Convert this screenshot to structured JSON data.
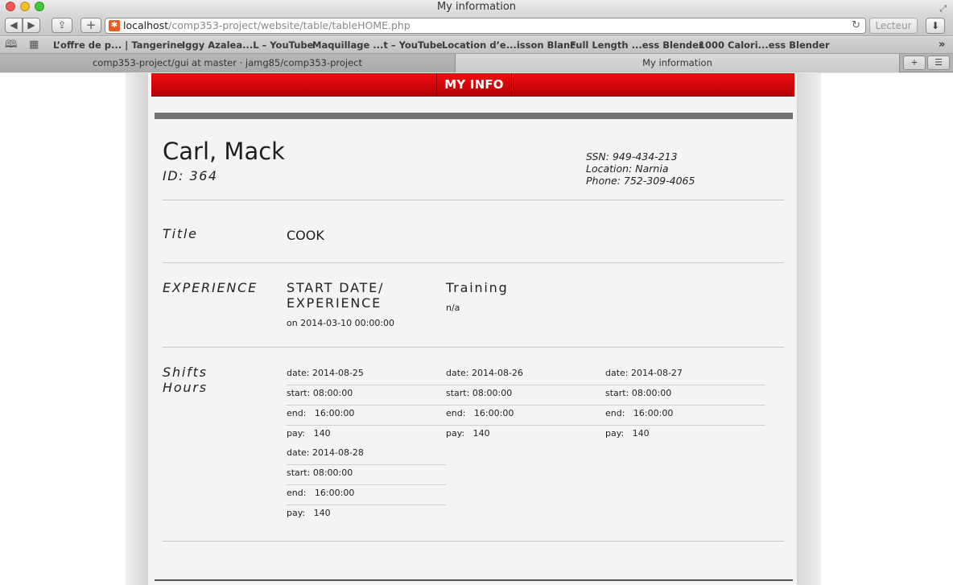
{
  "window": {
    "title": "My information"
  },
  "toolbar": {
    "back": "◀",
    "forward": "▶",
    "share": "⇪",
    "new_tab": "+",
    "url_host": "localhost",
    "url_path": "/comp353-project/website/table/tableHOME.php",
    "reader": "Lecteur",
    "reload": "↻",
    "download": "⬇"
  },
  "bookmarks": {
    "items": [
      "L’offre de p... | Tangerine",
      "Iggy Azalea...L – YouTube",
      "Maquillage ...t – YouTube",
      "Location d’e...isson Blanc",
      "Full Length ...ess Blender",
      "1000 Calori...ess Blender"
    ],
    "more": "»"
  },
  "tabs": [
    {
      "label": "comp353-project/gui at master · jamg85/comp353-project"
    },
    {
      "label": "My information"
    }
  ],
  "nav": {
    "my_info": "MY INFO"
  },
  "employee": {
    "name": "Carl, Mack",
    "id": "ID: 364",
    "ssn": "SSN: 949-434-213",
    "location": "Location: Narnia",
    "phone": "Phone: 752-309-4065"
  },
  "title_section": {
    "label": "Title",
    "value": "COOK"
  },
  "experience": {
    "label": "EXPERIENCE",
    "start_header_line1": "START DATE/",
    "start_header_line2": "EXPERIENCE",
    "start_value": "on 2014-03-10 00:00:00",
    "training_header": "Training",
    "training_value": "n/a"
  },
  "shifts": {
    "label_line1": "Shifts",
    "label_line2": "Hours",
    "items": [
      {
        "date": "date: 2014-08-25",
        "start": "start: 08:00:00",
        "end": "end:   16:00:00",
        "pay": "pay:   140"
      },
      {
        "date": "date: 2014-08-26",
        "start": "start: 08:00:00",
        "end": "end:   16:00:00",
        "pay": "pay:   140"
      },
      {
        "date": "date: 2014-08-27",
        "start": "start: 08:00:00",
        "end": "end:   16:00:00",
        "pay": "pay:   140"
      },
      {
        "date": "date: 2014-08-28",
        "start": "start: 08:00:00",
        "end": "end:   16:00:00",
        "pay": "pay:   140"
      }
    ]
  }
}
